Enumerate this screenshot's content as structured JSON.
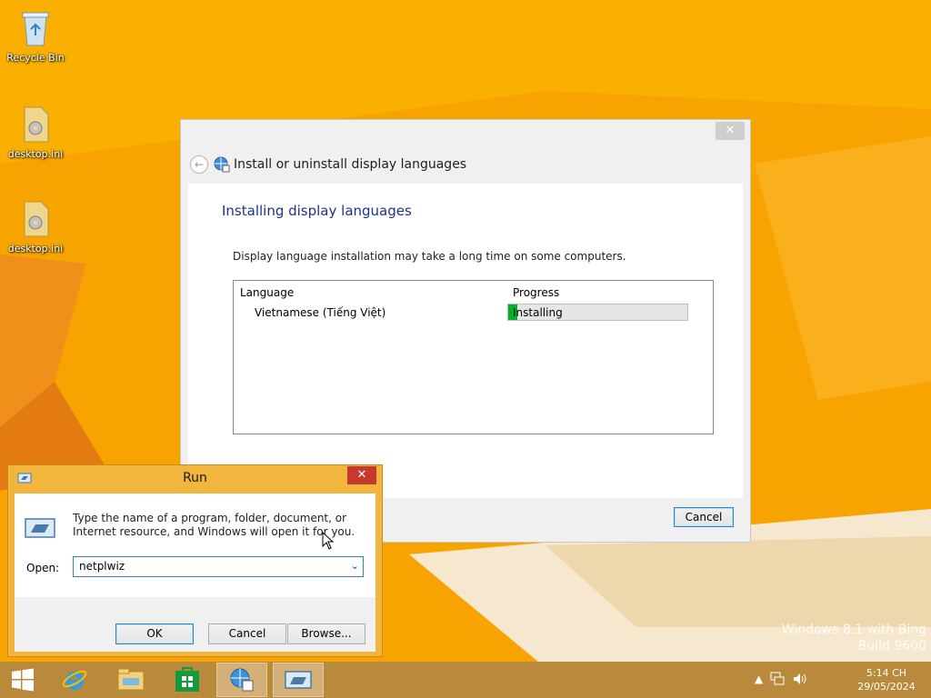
{
  "desktop": {
    "icons": [
      {
        "label": "Recycle Bin",
        "icon": "recycle-bin-icon"
      },
      {
        "label": "desktop.ini",
        "icon": "settings-file-icon"
      },
      {
        "label": "desktop.ini",
        "icon": "settings-file-icon"
      }
    ],
    "watermark": {
      "line1": "Windows 8.1 with Bing",
      "line2": "Build 9600"
    }
  },
  "language_window": {
    "title": "Install or uninstall display languages",
    "close_label": "✕",
    "heading": "Installing display languages",
    "info_text": "Display language installation may take a long time on some computers.",
    "columns": {
      "language": "Language",
      "progress": "Progress"
    },
    "rows": [
      {
        "language": "Vietnamese (Tiếng Việt)",
        "status": "Installing",
        "progress_fraction": 0.05
      }
    ],
    "cancel_label": "Cancel"
  },
  "run_dialog": {
    "title": "Run",
    "close_label": "✕",
    "description": "Type the name of a program, folder, document, or Internet resource, and Windows will open it for you.",
    "open_label": "Open:",
    "open_value": "netplwiz",
    "ok_label": "OK",
    "cancel_label": "Cancel",
    "browse_label": "Browse..."
  },
  "taskbar": {
    "apps": [
      "start-icon",
      "internet-explorer-icon",
      "file-explorer-icon",
      "store-icon",
      "language-settings-icon",
      "run-icon"
    ],
    "clock_time": "5:14 CH",
    "clock_date": "29/05/2024"
  },
  "colors": {
    "wallpaper": "#f6a300",
    "progress_green": "#06b025",
    "heading_blue": "#1e3287",
    "run_frame": "#f2b63f"
  }
}
